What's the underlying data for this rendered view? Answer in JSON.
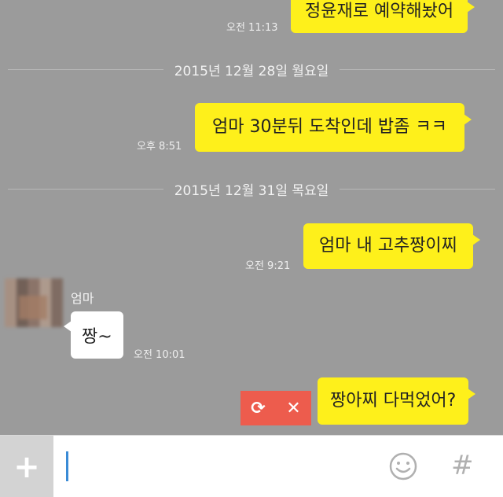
{
  "messages": [
    {
      "text": "정윤재로 예약해놨어",
      "time": "오전 11:13"
    },
    {
      "text": "엄마 30분뒤 도착인데 밥좀 ㅋㅋ",
      "time": "오후 8:51"
    },
    {
      "text": "엄마 내 고추짱이찌",
      "time": "오전 9:21"
    },
    {
      "text": "짱~",
      "time": "오전 10:01",
      "sender": "엄마"
    },
    {
      "text": "짱아찌 다먹었어?"
    }
  ],
  "dates": [
    "2015년 12월 28일 월요일",
    "2015년 12월 31일 목요일"
  ],
  "failed": {
    "retry_icon": "retry-icon",
    "delete_icon": "close-icon",
    "retry": "⟳",
    "delete": "✕"
  },
  "input_bar": {
    "plus": "+",
    "emoji_icon": "smile-icon",
    "hash": "#"
  },
  "colors": {
    "bubble_out": "#fef01b",
    "bubble_in": "#ffffff",
    "background": "#9b9b9b",
    "fail": "#ed5c4d"
  }
}
